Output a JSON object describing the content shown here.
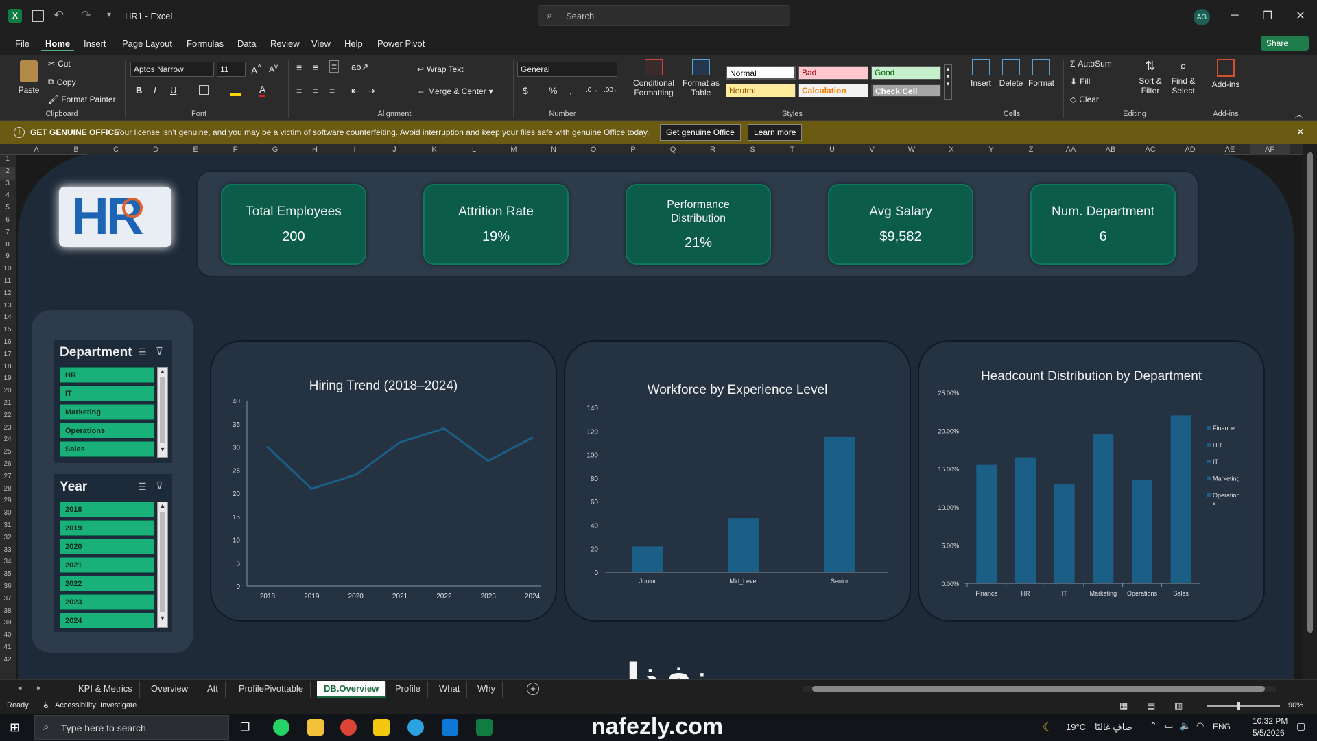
{
  "titlebar": {
    "doc_title": "HR1 - Excel",
    "search_placeholder": "Search",
    "avatar_initials": "AG",
    "minimize": "─",
    "restore": "❐",
    "close": "✕"
  },
  "menubar": {
    "items": [
      "File",
      "Home",
      "Insert",
      "Page Layout",
      "Formulas",
      "Data",
      "Review",
      "View",
      "Help",
      "Power Pivot"
    ],
    "share": "Share"
  },
  "ribbon": {
    "paste": "Paste",
    "cut": "Cut",
    "copy": "Copy",
    "format_painter": "Format Painter",
    "clipboard_label": "Clipboard",
    "font_name": "Aptos Narrow",
    "font_size": "11",
    "font_label": "Font",
    "wrap_text": "Wrap Text",
    "merge_center": "Merge & Center",
    "alignment_label": "Alignment",
    "number_format": "General",
    "number_label": "Number",
    "conditional_formatting": "Conditional Formatting",
    "format_as_table": "Format as Table",
    "styles": {
      "normal": "Normal",
      "bad": "Bad",
      "good": "Good",
      "neutral": "Neutral",
      "calculation": "Calculation",
      "check_cell": "Check Cell"
    },
    "styles_label": "Styles",
    "insert": "Insert",
    "delete": "Delete",
    "format": "Format",
    "cells_label": "Cells",
    "autosum": "AutoSum",
    "fill": "Fill",
    "clear": "Clear",
    "sort_filter": "Sort & Filter",
    "find_select": "Find & Select",
    "editing_label": "Editing",
    "addins": "Add-ins",
    "addins_label": "Add-ins"
  },
  "infobar": {
    "title": "GET GENUINE OFFICE",
    "message": "Your license isn't genuine, and you may be a victim of software counterfeiting. Avoid interruption and keep your files safe with genuine Office today.",
    "btn_genuine": "Get genuine Office",
    "btn_learn": "Learn more"
  },
  "columns": [
    "A",
    "B",
    "C",
    "D",
    "E",
    "F",
    "G",
    "H",
    "I",
    "J",
    "K",
    "L",
    "M",
    "N",
    "O",
    "P",
    "Q",
    "R",
    "S",
    "T",
    "U",
    "V",
    "W",
    "X",
    "Y",
    "Z",
    "AA",
    "AB",
    "AC",
    "AD",
    "AE",
    "AF"
  ],
  "rows": [
    "1",
    "2",
    "3",
    "4",
    "5",
    "6",
    "7",
    "8",
    "9",
    "10",
    "11",
    "12",
    "13",
    "14",
    "15",
    "16",
    "17",
    "18",
    "19",
    "20",
    "21",
    "22",
    "23",
    "24",
    "25",
    "26",
    "27",
    "28",
    "29",
    "30",
    "31",
    "32",
    "33",
    "34",
    "35",
    "36",
    "37",
    "38",
    "39",
    "40",
    "41",
    "42"
  ],
  "dashboard": {
    "logo_text": "HR",
    "kpis": [
      {
        "title": "Total Employees",
        "value": "200"
      },
      {
        "title": "Attrition Rate",
        "value": "19%"
      },
      {
        "title": "Performance Distribution",
        "value": "21%"
      },
      {
        "title": "Avg Salary",
        "value": "$9,582"
      },
      {
        "title": "Num. Department",
        "value": "6"
      }
    ],
    "slicer_department": {
      "title": "Department",
      "items": [
        "HR",
        "IT",
        "Marketing",
        "Operations",
        "Sales"
      ]
    },
    "slicer_year": {
      "title": "Year",
      "items": [
        "2018",
        "2019",
        "2020",
        "2021",
        "2022",
        "2023",
        "2024"
      ]
    }
  },
  "chart_data": [
    {
      "type": "line",
      "title": "Hiring Trend (2018–2024)",
      "x": [
        "2018",
        "2019",
        "2020",
        "2021",
        "2022",
        "2023",
        "2024"
      ],
      "values": [
        30,
        21,
        24,
        31,
        34,
        27,
        32
      ],
      "ylim": [
        0,
        40
      ],
      "yticks": [
        "0",
        "5",
        "10",
        "15",
        "20",
        "25",
        "30",
        "35",
        "40"
      ],
      "color": "#1c5f86"
    },
    {
      "type": "bar",
      "title": "Workforce by Experience Level",
      "categories": [
        "Junior",
        "Mid_Level",
        "Senior"
      ],
      "values": [
        22,
        46,
        115
      ],
      "ylim": [
        0,
        140
      ],
      "yticks": [
        "0",
        "20",
        "40",
        "60",
        "80",
        "100",
        "120",
        "140"
      ],
      "color": "#1c5f86"
    },
    {
      "type": "bar",
      "title": "Headcount Distribution by Department",
      "categories": [
        "Finance",
        "HR",
        "IT",
        "Marketing",
        "Operations",
        "Sales"
      ],
      "values": [
        15.5,
        16.5,
        13.0,
        19.5,
        13.5,
        22.0
      ],
      "ylim": [
        0,
        25
      ],
      "yticks": [
        "0.00%",
        "5.00%",
        "10.00%",
        "15.00%",
        "20.00%",
        "25.00%"
      ],
      "legend": [
        "Finance",
        "HR",
        "IT",
        "Marketing",
        "Operation s"
      ],
      "color": "#1c5f86"
    }
  ],
  "tabs": {
    "items": [
      "KPI & Metrics",
      "Overview",
      "Att",
      "ProfilePivottable",
      "DB.Overview",
      "Profile",
      "What",
      "Why"
    ],
    "active": "DB.Overview"
  },
  "watermark": {
    "arabic": "نفذلي",
    "latin": "nafezly.com"
  },
  "status": {
    "ready": "Ready",
    "accessibility": "Accessibility: Investigate",
    "zoom": "90%"
  },
  "taskbar": {
    "search_placeholder": "Type here to search",
    "weather": "19°C",
    "weather_desc": "صافٍ غالبًا",
    "lang": "ENG",
    "time": "10:32 PM",
    "date": "5/5/2026"
  }
}
